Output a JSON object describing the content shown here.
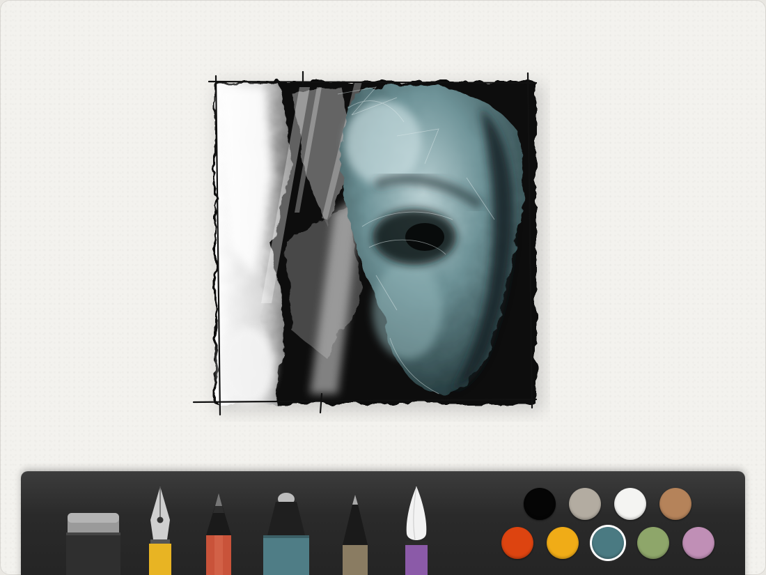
{
  "app": {
    "background": "#f3f2ee"
  },
  "artwork": {
    "subject": "painted-face-sketch"
  },
  "tools": [
    {
      "name": "eraser",
      "icon": "eraser-icon",
      "color": "#2f2f2f"
    },
    {
      "name": "fountain-pen",
      "icon": "fountain-pen-icon",
      "color": "#e8b423"
    },
    {
      "name": "pencil",
      "icon": "pencil-icon",
      "color": "#c9533a"
    },
    {
      "name": "marker",
      "icon": "marker-icon",
      "color": "#4f7d86"
    },
    {
      "name": "outline-pen",
      "icon": "outline-pen-icon",
      "color": "#8a7c62"
    },
    {
      "name": "watercolor-brush",
      "icon": "brush-icon",
      "color": "#8b5aa8",
      "selected": true
    }
  ],
  "palette": {
    "colors": [
      {
        "name": "black",
        "hex": "#050505"
      },
      {
        "name": "warm-gray",
        "hex": "#b3aca1"
      },
      {
        "name": "white",
        "hex": "#f4f4f2"
      },
      {
        "name": "tan",
        "hex": "#b5835a"
      },
      {
        "name": "orange-red",
        "hex": "#dd4410"
      },
      {
        "name": "yellow",
        "hex": "#f0ac17"
      },
      {
        "name": "teal",
        "hex": "#4a7a82",
        "selected": true
      },
      {
        "name": "sage-green",
        "hex": "#8ea66a"
      },
      {
        "name": "lilac",
        "hex": "#c08fb6"
      }
    ]
  }
}
